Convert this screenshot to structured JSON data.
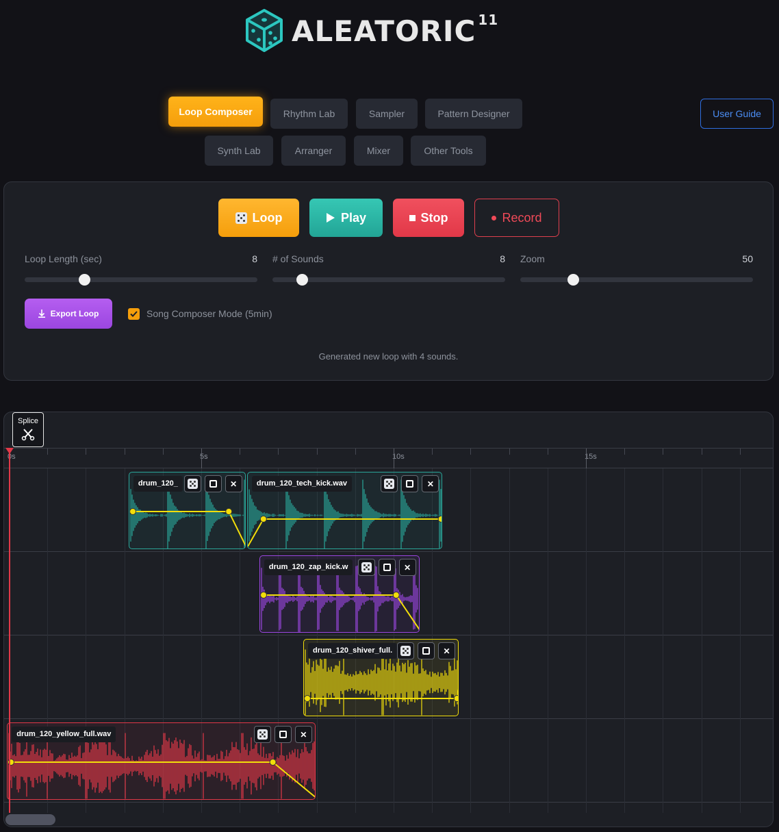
{
  "logo": {
    "text": "ALEATORIC",
    "superscript": "11",
    "accent": "#2cc7c0"
  },
  "nav": {
    "row1": [
      "Loop Composer",
      "Rhythm Lab",
      "Sampler",
      "Pattern Designer"
    ],
    "row2": [
      "Synth Lab",
      "Arranger",
      "Mixer",
      "Other Tools"
    ],
    "active": "Loop Composer",
    "user_guide": "User Guide"
  },
  "transport": {
    "loop": "Loop",
    "play": "Play",
    "stop": "Stop",
    "record": "Record"
  },
  "sliders": [
    {
      "label": "Loop Length (sec)",
      "value": "8",
      "fraction": 0.255
    },
    {
      "label": "# of Sounds",
      "value": "8",
      "fraction": 0.125
    },
    {
      "label": "Zoom",
      "value": "50",
      "fraction": 0.225
    }
  ],
  "export_label": "Export Loop",
  "song_mode": {
    "label": "Song Composer Mode (5min)",
    "checked": true
  },
  "status": "Generated new loop with 4 sounds.",
  "timeline": {
    "splice_label": "Splice",
    "ruler_labels": [
      "0s",
      "5s",
      "10s",
      "15s"
    ],
    "clips": [
      {
        "name": "drum_120_",
        "color": "#2aa79a",
        "lane": 0,
        "start_sec": 3.2,
        "end_sec": 6.24
      },
      {
        "name": "drum_120_tech_kick.wav",
        "color": "#2aa79a",
        "lane": 0,
        "start_sec": 6.28,
        "end_sec": 11.36
      },
      {
        "name": "drum_120_zap_kick.w",
        "color": "#9b46e0",
        "lane": 1,
        "start_sec": 6.6,
        "end_sec": 10.76
      },
      {
        "name": "drum_120_shiver_full.",
        "color": "#f2de0a",
        "lane": 2,
        "start_sec": 7.74,
        "end_sec": 11.78
      },
      {
        "name": "drum_120_yellow_full.wav",
        "color": "#e23848",
        "lane": 3,
        "start_sec": 0.04,
        "end_sec": 8.06
      }
    ]
  }
}
